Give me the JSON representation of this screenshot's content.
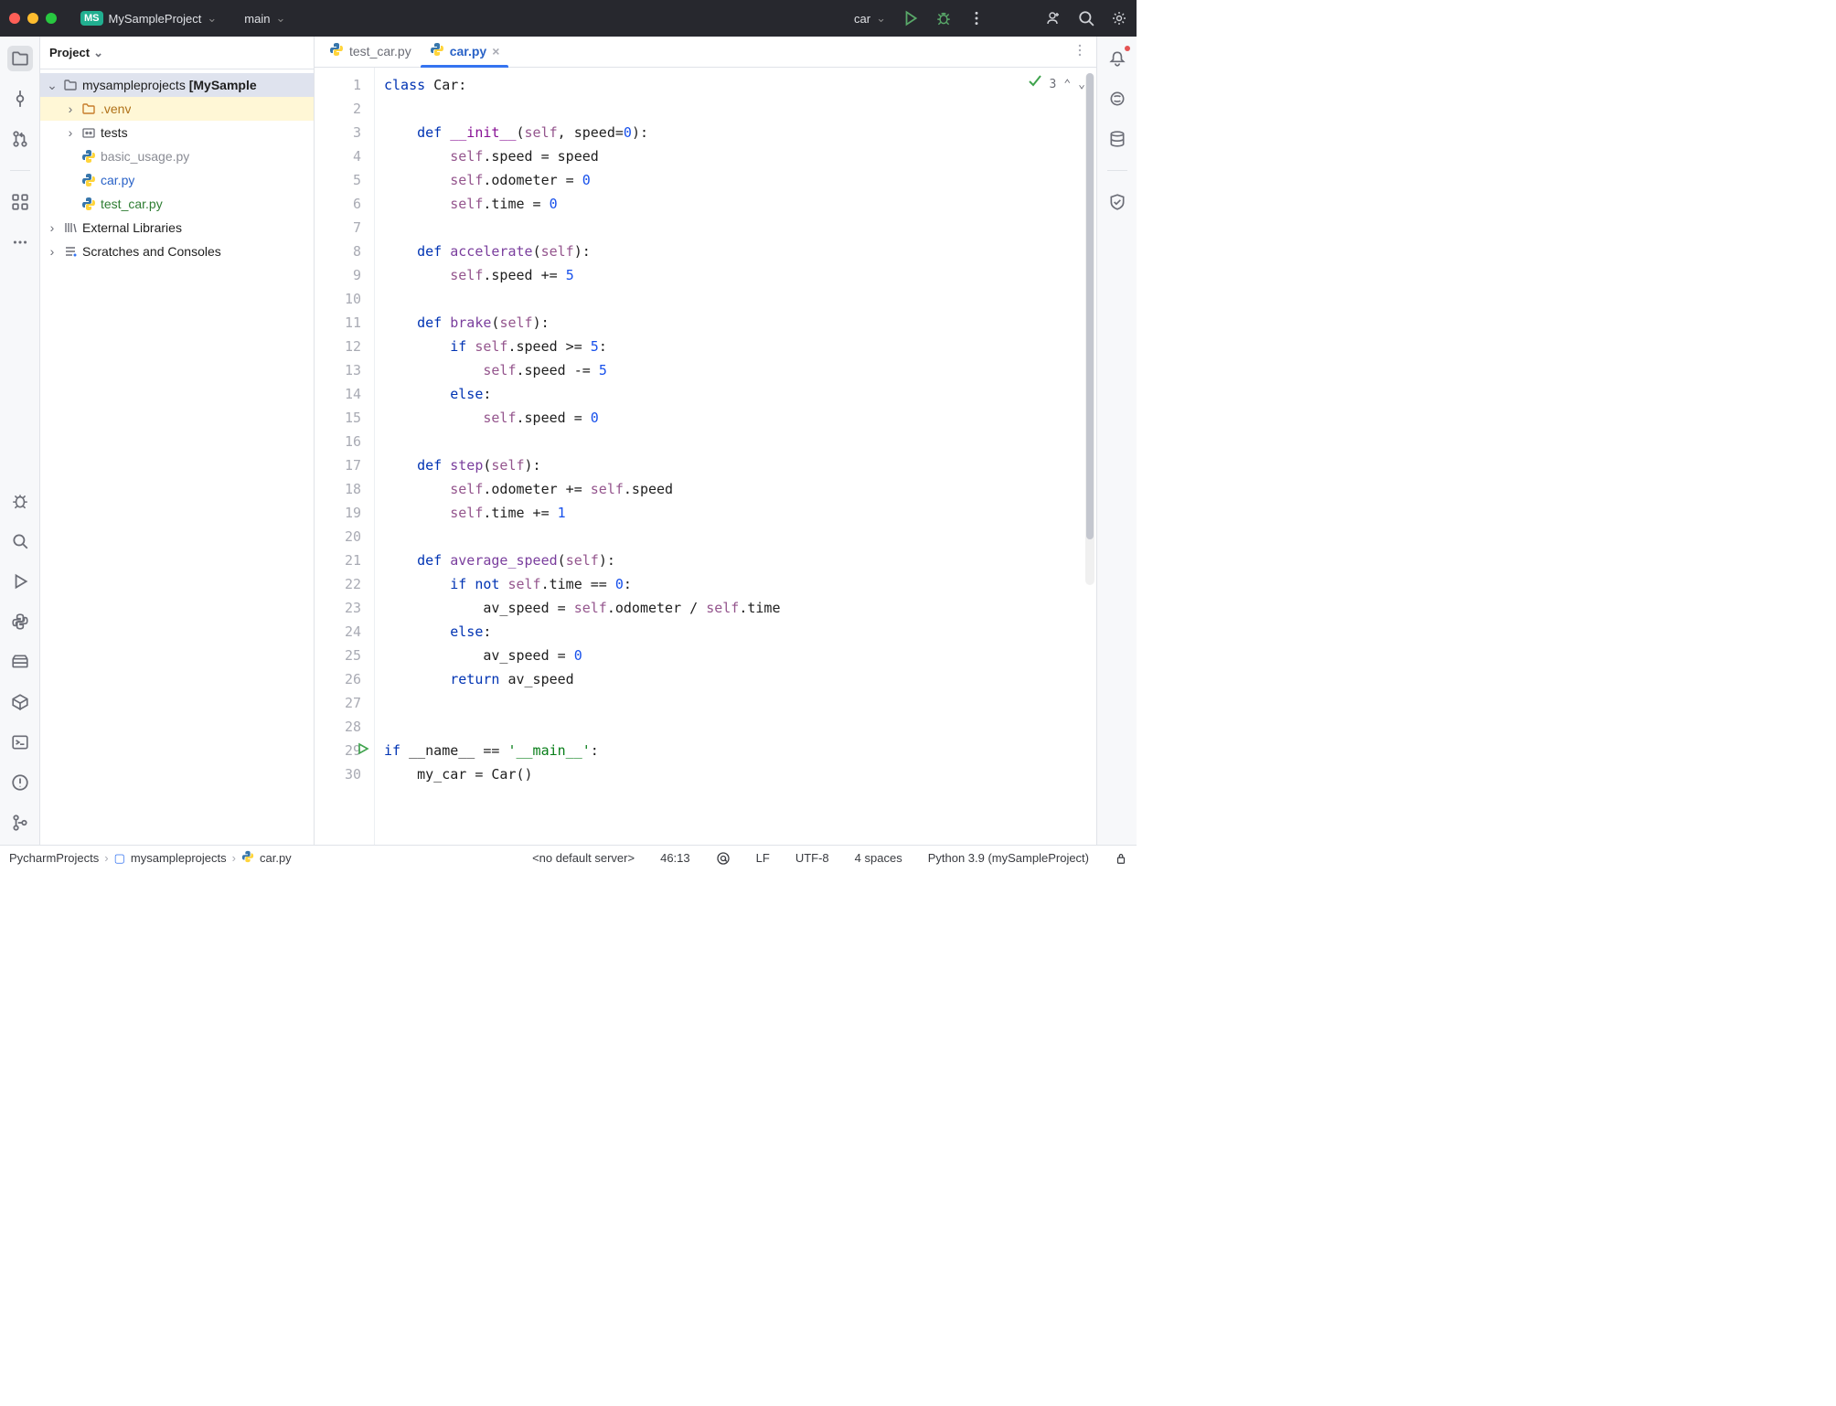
{
  "titlebar": {
    "project_badge": "MS",
    "project_name": "MySampleProject",
    "branch": "main",
    "run_config": "car"
  },
  "left_rail": {
    "items_top": [
      "folder",
      "commit",
      "branches-alt",
      "structure",
      "more"
    ],
    "items_bottom": [
      "bug",
      "search",
      "run",
      "python",
      "stack",
      "services",
      "terminal",
      "warning",
      "pr"
    ]
  },
  "project_panel": {
    "title": "Project"
  },
  "tree": {
    "root_label": "mysampleprojects",
    "root_context": "[MySample",
    "venv": ".venv",
    "tests": "tests",
    "files": {
      "basic": "basic_usage.py",
      "car": "car.py",
      "test": "test_car.py"
    },
    "external": "External Libraries",
    "scratches": "Scratches and Consoles"
  },
  "tabs": {
    "inactive": "test_car.py",
    "active": "car.py"
  },
  "editor": {
    "problems_count": "3"
  },
  "code": {
    "lines": [
      {
        "n": 1,
        "html": "<span class='k'>class</span> Car:"
      },
      {
        "n": 2,
        "html": ""
      },
      {
        "n": 3,
        "html": "    <span class='k'>def</span> <span class='dunder'>__init__</span>(<span class='self'>self</span>, speed=<span class='num'>0</span>):"
      },
      {
        "n": 4,
        "html": "        <span class='self'>self</span>.speed = speed"
      },
      {
        "n": 5,
        "html": "        <span class='self'>self</span>.odometer = <span class='num'>0</span>"
      },
      {
        "n": 6,
        "html": "        <span class='self'>self</span>.time = <span class='num'>0</span>"
      },
      {
        "n": 7,
        "html": ""
      },
      {
        "n": 8,
        "html": "    <span class='k'>def</span> <span class='fn'>accelerate</span>(<span class='self'>self</span>):"
      },
      {
        "n": 9,
        "html": "        <span class='self'>self</span>.speed += <span class='num'>5</span>"
      },
      {
        "n": 10,
        "html": ""
      },
      {
        "n": 11,
        "html": "    <span class='k'>def</span> <span class='fn'>brake</span>(<span class='self'>self</span>):"
      },
      {
        "n": 12,
        "html": "        <span class='k'>if</span> <span class='self'>self</span>.speed &gt;= <span class='num'>5</span>:"
      },
      {
        "n": 13,
        "html": "            <span class='self'>self</span>.speed -= <span class='num'>5</span>"
      },
      {
        "n": 14,
        "html": "        <span class='k'>else</span>:"
      },
      {
        "n": 15,
        "html": "            <span class='self'>self</span>.speed = <span class='num'>0</span>"
      },
      {
        "n": 16,
        "html": ""
      },
      {
        "n": 17,
        "html": "    <span class='k'>def</span> <span class='fn'>step</span>(<span class='self'>self</span>):"
      },
      {
        "n": 18,
        "html": "        <span class='self'>self</span>.odometer += <span class='self'>self</span>.speed"
      },
      {
        "n": 19,
        "html": "        <span class='self'>self</span>.time += <span class='num'>1</span>"
      },
      {
        "n": 20,
        "html": ""
      },
      {
        "n": 21,
        "html": "    <span class='k'>def</span> <span class='fn'>average_speed</span>(<span class='self'>self</span>):"
      },
      {
        "n": 22,
        "html": "        <span class='k'>if not</span> <span class='self'>self</span>.time == <span class='num'>0</span>:"
      },
      {
        "n": 23,
        "html": "            av_speed = <span class='self'>self</span>.odometer / <span class='self'>self</span>.time"
      },
      {
        "n": 24,
        "html": "        <span class='k'>else</span>:"
      },
      {
        "n": 25,
        "html": "            av_speed = <span class='num'>0</span>"
      },
      {
        "n": 26,
        "html": "        <span class='k'>return</span> av_speed"
      },
      {
        "n": 27,
        "html": ""
      },
      {
        "n": 28,
        "html": ""
      },
      {
        "n": 29,
        "html": "<span class='k'>if</span> __name__ == <span class='str'>'__main__'</span>:"
      },
      {
        "n": 30,
        "html": "    my_car = Car()"
      }
    ]
  },
  "statusbar": {
    "crumb1": "PycharmProjects",
    "crumb2": "mysampleprojects",
    "crumb3": "car.py",
    "server": "<no default server>",
    "pos": "46:13",
    "le": "LF",
    "enc": "UTF-8",
    "indent": "4 spaces",
    "interpreter": "Python 3.9 (mySampleProject)"
  }
}
